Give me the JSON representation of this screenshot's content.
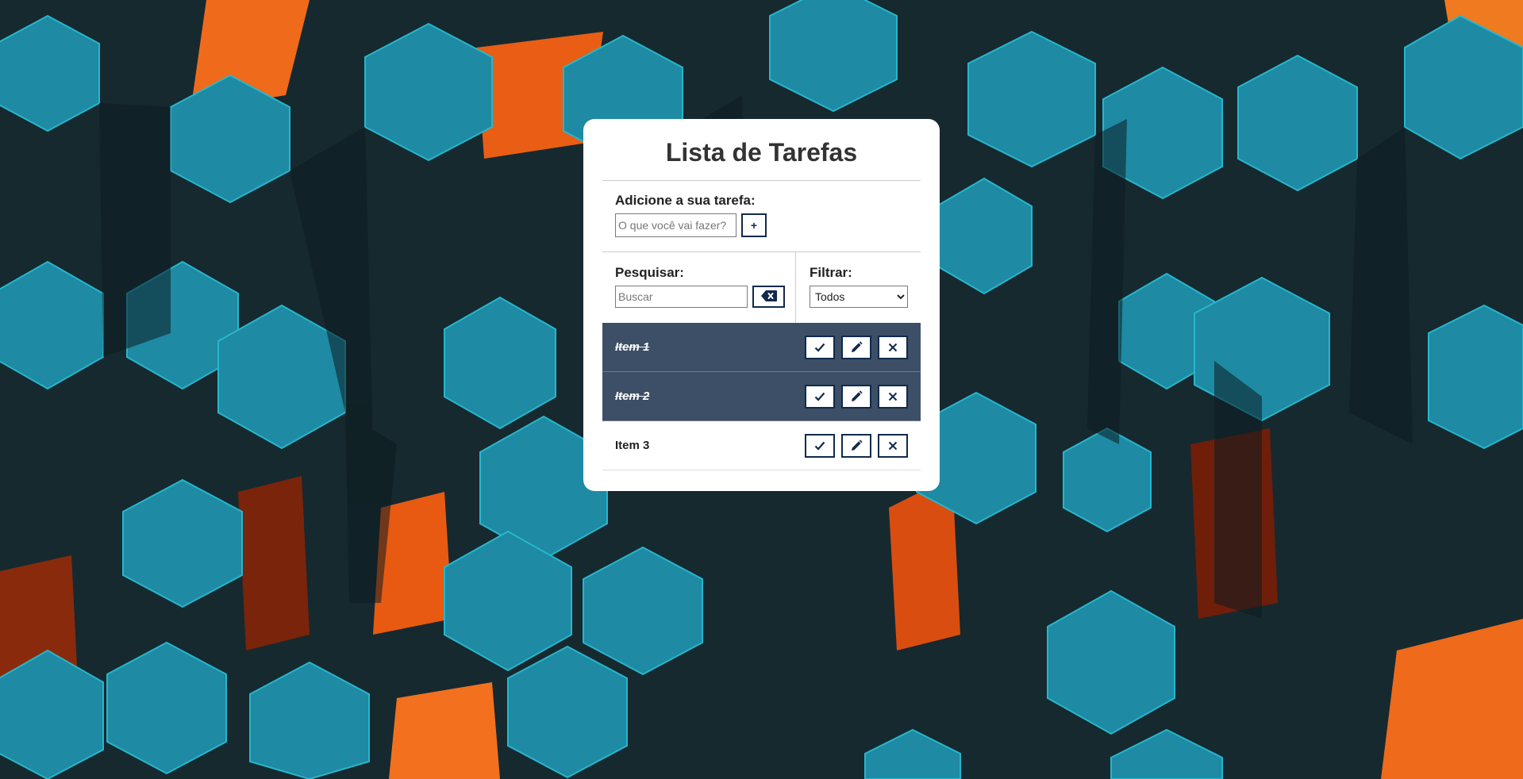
{
  "app": {
    "title": "Lista de Tarefas"
  },
  "add": {
    "label": "Adicione a sua tarefa:",
    "input_value": "",
    "input_placeholder": "O que você vai fazer?",
    "add_button_label": "+"
  },
  "search": {
    "label": "Pesquisar:",
    "input_value": "",
    "input_placeholder": "Buscar",
    "clear_icon": "backspace-icon"
  },
  "filter": {
    "label": "Filtrar:",
    "selected": "Todos"
  },
  "todos": [
    {
      "text": "Item 1",
      "done": true
    },
    {
      "text": "Item 2",
      "done": true
    },
    {
      "text": "Item 3",
      "done": false
    }
  ],
  "todo_actions": [
    "check-icon",
    "pen-icon",
    "x-icon"
  ],
  "colors": {
    "accent": "#102a4c",
    "done_row": "#3c4f66",
    "card": "#ffffff",
    "teal": "#1e8fa8",
    "orange": "#f06a1c"
  }
}
